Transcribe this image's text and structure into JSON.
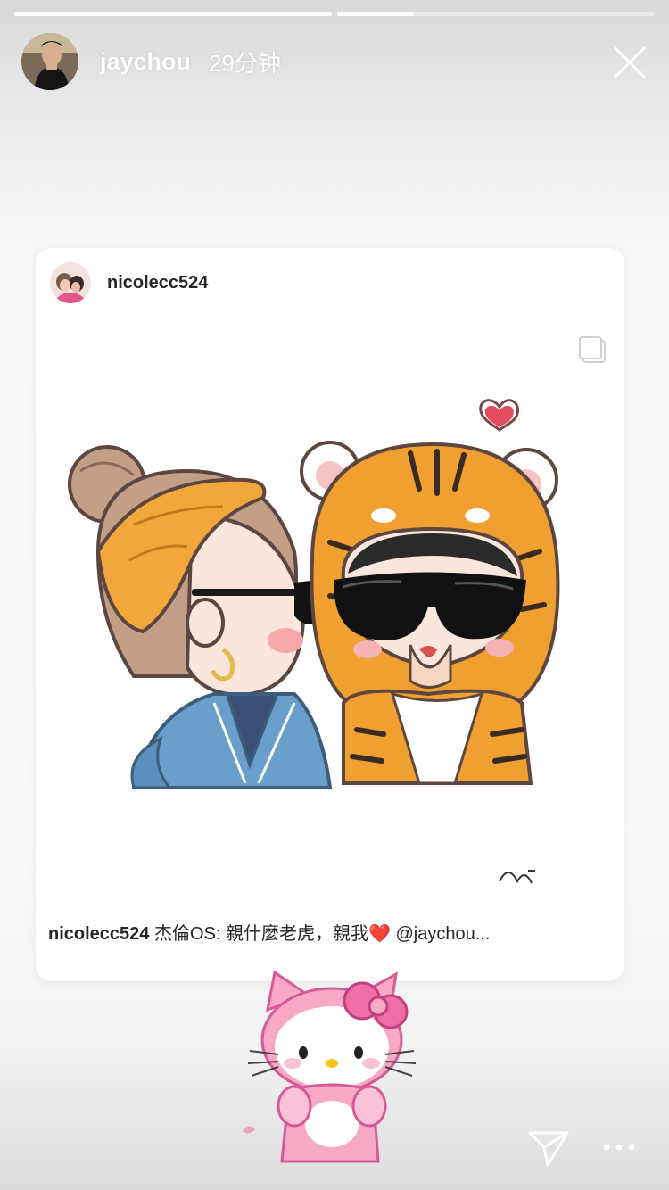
{
  "story": {
    "username": "jaychou",
    "time_ago": "29分钟",
    "progress": [
      1.0,
      0.24
    ],
    "avatar_icon": "user-avatar"
  },
  "post": {
    "username": "nicolecc524",
    "caption_user": "nicolecc524",
    "caption_text": "杰倫OS: 親什麼老虎，親我❤️ @jaychou..."
  },
  "icons": {
    "close": "close-icon",
    "multi": "multiple-photos-icon",
    "send": "send-icon",
    "more": "more-icon"
  },
  "colors": {
    "tiger_orange": "#f0a030",
    "headband": "#f2a73c",
    "jacket": "#6a9fcb",
    "heart": "#e34b5f",
    "kitty_pink": "#f7a9c5"
  }
}
